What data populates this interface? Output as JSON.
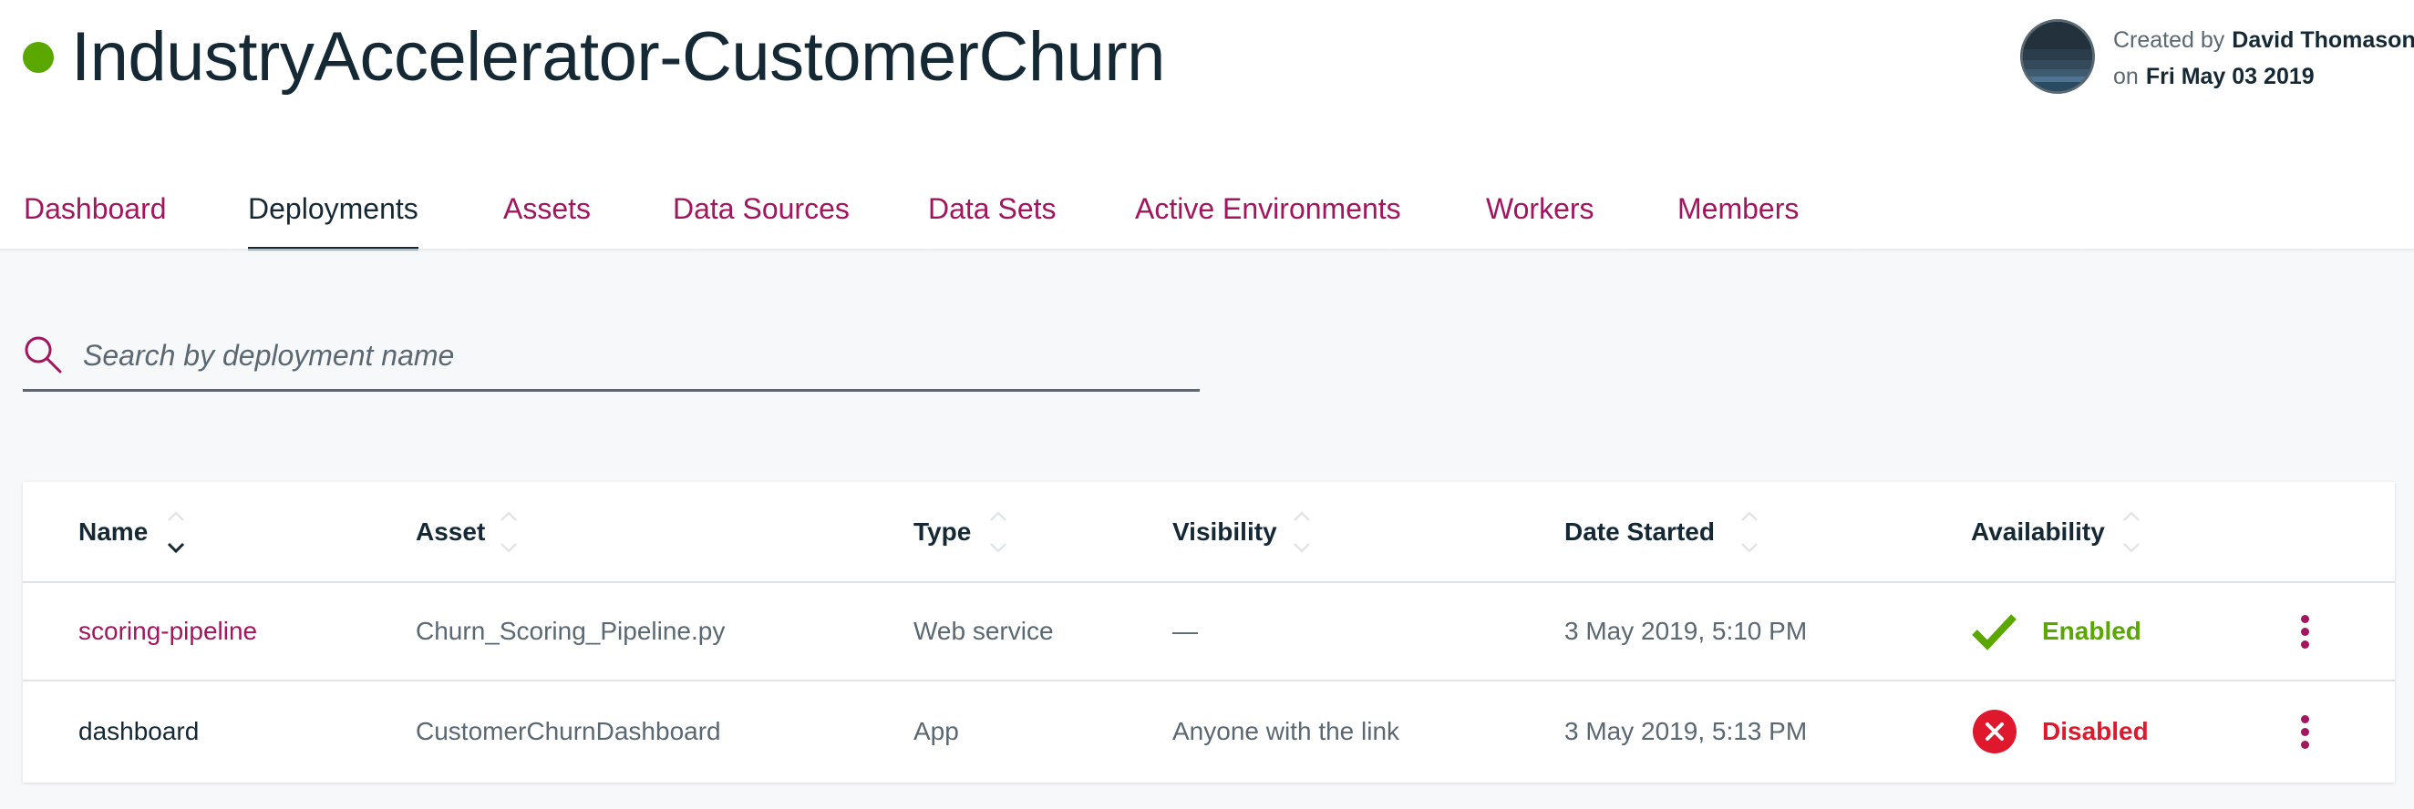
{
  "project": {
    "title": "IndustryAccelerator-CustomerChurn",
    "status_color": "#5aa700"
  },
  "creator": {
    "created_by_label": "Created by",
    "name": "David Thomason",
    "on_label": "on",
    "date": "Fri May 03 2019"
  },
  "tabs": [
    {
      "label": "Dashboard",
      "active": false
    },
    {
      "label": "Deployments",
      "active": true
    },
    {
      "label": "Assets",
      "active": false
    },
    {
      "label": "Data Sources",
      "active": false
    },
    {
      "label": "Data Sets",
      "active": false
    },
    {
      "label": "Active Environments",
      "active": false
    },
    {
      "label": "Workers",
      "active": false
    },
    {
      "label": "Members",
      "active": false
    }
  ],
  "search": {
    "placeholder": "Search by deployment name",
    "value": "",
    "icon": "search-icon"
  },
  "table": {
    "columns": [
      "Name",
      "Asset",
      "Type",
      "Visibility",
      "Date Started",
      "Availability"
    ],
    "sorted_column": "Name",
    "sort_direction": "descending",
    "rows": [
      {
        "name": "scoring-pipeline",
        "asset": "Churn_Scoring_Pipeline.py",
        "type": "Web service",
        "visibility": "—",
        "date_started": "3 May 2019, 5:10 PM",
        "availability": "Enabled",
        "availability_icon": "checkmark-icon",
        "availability_color": "#5aa700"
      },
      {
        "name": "dashboard",
        "asset": "CustomerChurnDashboard",
        "type": "App",
        "visibility": "Anyone with the link",
        "date_started": "3 May 2019, 5:13 PM",
        "availability": "Disabled",
        "availability_icon": "error-icon",
        "availability_color": "#e0182d"
      }
    ]
  },
  "colors": {
    "accent": "#a1165c",
    "text": "#152935",
    "muted": "#5a6872",
    "enabled": "#5aa700",
    "disabled": "#e0182d"
  }
}
